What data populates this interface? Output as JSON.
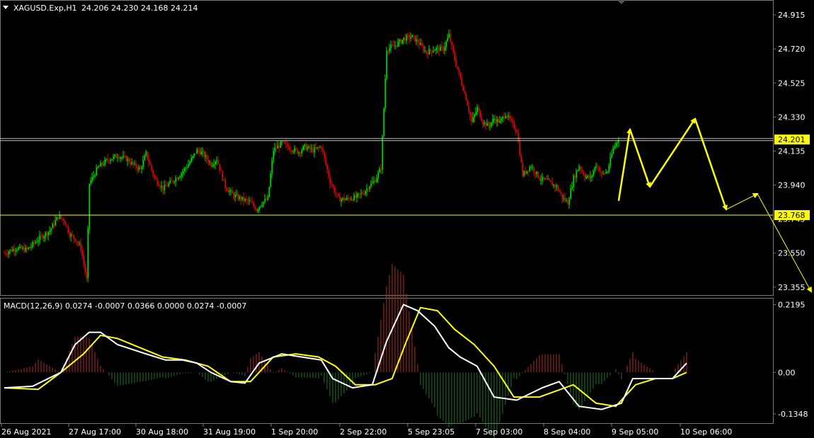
{
  "header": {
    "symbol": "XAGUSD.Exp,H1",
    "ohlc": "24.206 24.230 24.168 24.214"
  },
  "macd_header": "MACD(12,26,9) 0.0274 -0.0007 0.0366 0.0000 0.0274 -0.0007",
  "colors": {
    "background": "#000000",
    "bull": "#00e000",
    "bear": "#cc1010",
    "level": "#ffff00",
    "price_line": "#c0c0c0",
    "macd_line": "#ffffff",
    "signal_line": "#ffff00",
    "hist_pos": "#b03020",
    "hist_neg": "#1f7a1f",
    "arrow": "#ffff00"
  },
  "chart_data": [
    {
      "type": "candlestick",
      "ylim": [
        23.33,
        24.96
      ],
      "y_ticks": [
        "24.915",
        "24.720",
        "24.525",
        "24.330",
        "24.135",
        "23.940",
        "23.745",
        "23.550",
        "23.355"
      ],
      "x_ticks": [
        "26 Aug 2021",
        "27 Aug 17:00",
        "30 Aug 18:00",
        "31 Aug 19:00",
        "1 Sep 20:00",
        "2 Sep 22:00",
        "5 Sep 23:05",
        "7 Sep 03:00",
        "8 Sep 04:00",
        "9 Sep 05:00",
        "10 Sep 06:00"
      ],
      "price_line": {
        "value": 24.201,
        "label": "24.201"
      },
      "level_line": {
        "value": 23.768,
        "label": "23.768"
      },
      "close_path": [
        [
          0,
          23.55
        ],
        [
          8,
          23.58
        ],
        [
          16,
          23.57
        ],
        [
          24,
          23.63
        ],
        [
          32,
          23.68
        ],
        [
          38,
          23.76
        ],
        [
          42,
          23.74
        ],
        [
          46,
          23.66
        ],
        [
          50,
          23.63
        ],
        [
          54,
          23.58
        ],
        [
          58,
          23.4
        ],
        [
          60,
          23.95
        ],
        [
          66,
          24.04
        ],
        [
          72,
          24.08
        ],
        [
          80,
          24.11
        ],
        [
          86,
          24.09
        ],
        [
          92,
          24.05
        ],
        [
          96,
          24.03
        ],
        [
          100,
          24.12
        ],
        [
          106,
          23.98
        ],
        [
          112,
          23.92
        ],
        [
          118,
          23.96
        ],
        [
          124,
          24.0
        ],
        [
          130,
          24.06
        ],
        [
          136,
          24.14
        ],
        [
          140,
          24.12
        ],
        [
          146,
          24.06
        ],
        [
          150,
          24.09
        ],
        [
          156,
          23.93
        ],
        [
          162,
          23.88
        ],
        [
          168,
          23.86
        ],
        [
          174,
          23.84
        ],
        [
          178,
          23.8
        ],
        [
          182,
          23.84
        ],
        [
          186,
          23.86
        ],
        [
          190,
          24.14
        ],
        [
          196,
          24.18
        ],
        [
          202,
          24.15
        ],
        [
          208,
          24.13
        ],
        [
          212,
          24.16
        ],
        [
          218,
          24.14
        ],
        [
          224,
          24.16
        ],
        [
          230,
          23.96
        ],
        [
          236,
          23.86
        ],
        [
          242,
          23.86
        ],
        [
          248,
          23.87
        ],
        [
          254,
          23.9
        ],
        [
          258,
          23.94
        ],
        [
          262,
          23.97
        ],
        [
          266,
          24.04
        ],
        [
          270,
          24.72
        ],
        [
          276,
          24.74
        ],
        [
          282,
          24.78
        ],
        [
          288,
          24.79
        ],
        [
          292,
          24.76
        ],
        [
          298,
          24.7
        ],
        [
          304,
          24.72
        ],
        [
          310,
          24.72
        ],
        [
          314,
          24.8
        ],
        [
          318,
          24.66
        ],
        [
          322,
          24.55
        ],
        [
          326,
          24.44
        ],
        [
          330,
          24.3
        ],
        [
          334,
          24.38
        ],
        [
          338,
          24.3
        ],
        [
          342,
          24.28
        ],
        [
          346,
          24.32
        ],
        [
          350,
          24.3
        ],
        [
          354,
          24.35
        ],
        [
          358,
          24.3
        ],
        [
          362,
          24.25
        ],
        [
          366,
          24.0
        ],
        [
          372,
          24.05
        ],
        [
          378,
          23.98
        ],
        [
          384,
          23.96
        ],
        [
          390,
          23.93
        ],
        [
          394,
          23.87
        ],
        [
          398,
          23.84
        ],
        [
          402,
          23.98
        ],
        [
          406,
          24.05
        ],
        [
          410,
          23.99
        ],
        [
          414,
          23.98
        ],
        [
          418,
          24.06
        ],
        [
          422,
          24.0
        ],
        [
          426,
          24.02
        ],
        [
          430,
          24.15
        ],
        [
          434,
          24.21
        ]
      ],
      "annotation_arrows": [
        [
          [
            434,
            23.85
          ],
          [
            442,
            24.26
          ]
        ],
        [
          [
            442,
            24.26
          ],
          [
            456,
            23.93
          ]
        ],
        [
          [
            456,
            23.93
          ],
          [
            488,
            24.32
          ]
        ],
        [
          [
            488,
            24.32
          ],
          [
            510,
            23.8
          ]
        ],
        [
          [
            510,
            23.8
          ],
          [
            532,
            23.89
          ]
        ],
        [
          [
            532,
            23.89
          ],
          [
            570,
            23.33
          ]
        ]
      ]
    },
    {
      "type": "macd",
      "ylim": [
        -0.16,
        0.23
      ],
      "y_ticks": [
        "0.2195",
        "0.00",
        "-0.1348"
      ],
      "macd_path": [
        [
          0,
          -0.05
        ],
        [
          20,
          -0.045
        ],
        [
          40,
          0.0
        ],
        [
          50,
          0.09
        ],
        [
          60,
          0.13
        ],
        [
          68,
          0.13
        ],
        [
          80,
          0.09
        ],
        [
          100,
          0.06
        ],
        [
          114,
          0.04
        ],
        [
          126,
          0.04
        ],
        [
          136,
          0.03
        ],
        [
          146,
          0.0
        ],
        [
          160,
          -0.03
        ],
        [
          170,
          -0.035
        ],
        [
          180,
          0.03
        ],
        [
          196,
          0.06
        ],
        [
          210,
          0.05
        ],
        [
          224,
          0.04
        ],
        [
          232,
          -0.02
        ],
        [
          246,
          -0.05
        ],
        [
          260,
          -0.04
        ],
        [
          270,
          0.1
        ],
        [
          282,
          0.22
        ],
        [
          292,
          0.2
        ],
        [
          304,
          0.15
        ],
        [
          314,
          0.08
        ],
        [
          322,
          0.05
        ],
        [
          334,
          0.02
        ],
        [
          346,
          -0.08
        ],
        [
          362,
          -0.09
        ],
        [
          380,
          -0.05
        ],
        [
          392,
          -0.03
        ],
        [
          406,
          -0.11
        ],
        [
          422,
          -0.12
        ],
        [
          436,
          -0.1
        ],
        [
          444,
          -0.02
        ],
        [
          460,
          -0.02
        ],
        [
          472,
          -0.02
        ],
        [
          482,
          0.03
        ]
      ],
      "signal_path": [
        [
          0,
          -0.05
        ],
        [
          24,
          -0.055
        ],
        [
          40,
          0.0
        ],
        [
          56,
          0.06
        ],
        [
          68,
          0.12
        ],
        [
          80,
          0.11
        ],
        [
          96,
          0.08
        ],
        [
          112,
          0.05
        ],
        [
          128,
          0.04
        ],
        [
          144,
          0.02
        ],
        [
          160,
          -0.03
        ],
        [
          174,
          -0.03
        ],
        [
          190,
          0.05
        ],
        [
          206,
          0.06
        ],
        [
          222,
          0.05
        ],
        [
          234,
          0.02
        ],
        [
          248,
          -0.04
        ],
        [
          262,
          -0.04
        ],
        [
          274,
          -0.02
        ],
        [
          284,
          0.1
        ],
        [
          294,
          0.21
        ],
        [
          306,
          0.2
        ],
        [
          318,
          0.14
        ],
        [
          332,
          0.09
        ],
        [
          346,
          0.02
        ],
        [
          360,
          -0.08
        ],
        [
          378,
          -0.08
        ],
        [
          390,
          -0.06
        ],
        [
          402,
          -0.04
        ],
        [
          418,
          -0.1
        ],
        [
          432,
          -0.11
        ],
        [
          446,
          -0.04
        ],
        [
          460,
          -0.02
        ],
        [
          472,
          -0.02
        ],
        [
          482,
          0.0
        ]
      ]
    }
  ]
}
